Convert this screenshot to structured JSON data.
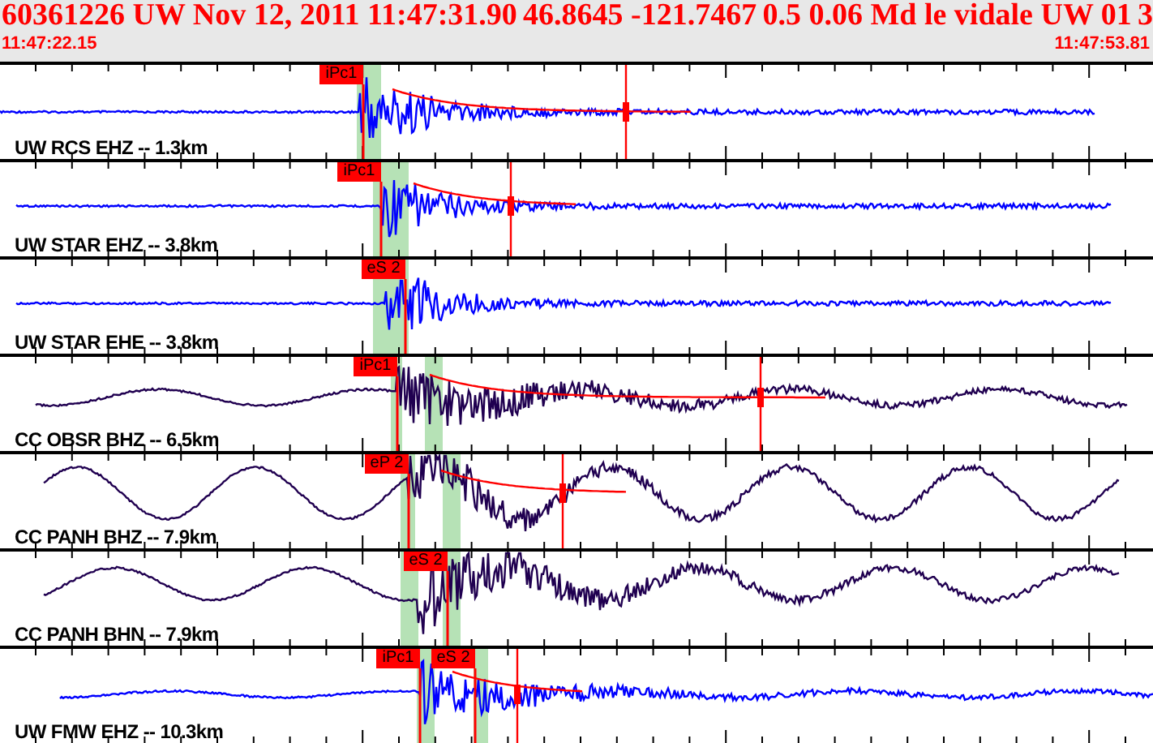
{
  "header": {
    "title_parts": [
      "60361226 UW Nov 12, 2011 11:47:31.90",
      "46.8645 -121.7467",
      "0.5 0.06 Md le vidale UW 01",
      "3"
    ],
    "start_time": "11:47:22.15",
    "end_time": "11:47:53.81"
  },
  "traces": [
    {
      "label": "UW RCS EHZ -- 1.3km",
      "color": "#0000ff",
      "picks": [
        "iPc1"
      ]
    },
    {
      "label": "UW STAR EHZ -- 3.8km",
      "color": "#0000ff",
      "picks": [
        "iPc1"
      ]
    },
    {
      "label": "UW STAR EHE -- 3.8km",
      "color": "#0000ff",
      "picks": [
        "eS 2"
      ]
    },
    {
      "label": "CC OBSR BHZ -- 6.5km",
      "color": "#200050",
      "picks": [
        "iPc1"
      ]
    },
    {
      "label": "CC PANH BHZ -- 7.9km",
      "color": "#200050",
      "picks": [
        "eP 2"
      ]
    },
    {
      "label": "CC PANH BHN -- 7.9km",
      "color": "#200050",
      "picks": [
        "eS 2"
      ]
    },
    {
      "label": "UW FMW EHZ -- 10.3km",
      "color": "#0000ff",
      "picks": [
        "iPc1",
        "eS 2"
      ]
    }
  ]
}
